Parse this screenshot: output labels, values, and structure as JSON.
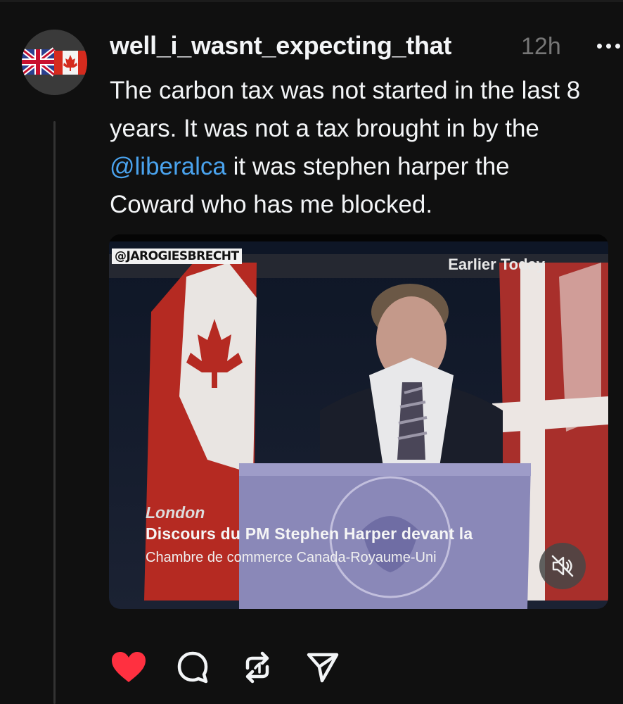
{
  "post": {
    "username": "well_i_wasnt_expecting_that",
    "time": "12h",
    "text_lines": [
      "The carbon tax was not started in the last 8",
      "years. It was not a tax brought in by the",
      "it was stephen harper the",
      "Coward who has me blocked."
    ],
    "mention": "@liberalca"
  },
  "media": {
    "watermark": "@JAROGIESBRECHT",
    "overlay_top": "Earlier Today",
    "location": "London",
    "headline_line1": "Discours du PM Stephen Harper devant la",
    "headline_line2": "Chambre de commerce Canada-Royaume-Uni",
    "mute_icon": "speaker-muted-icon"
  },
  "actions": [
    {
      "name": "like",
      "icon": "heart-filled-icon",
      "liked": true
    },
    {
      "name": "reply",
      "icon": "comment-icon"
    },
    {
      "name": "repost",
      "icon": "repost-icon"
    },
    {
      "name": "share",
      "icon": "send-icon"
    }
  ],
  "colors": {
    "background": "#101010",
    "text": "#f3f5f7",
    "muted": "#777777",
    "mention": "#4aa3ee",
    "like": "#ff3040"
  }
}
